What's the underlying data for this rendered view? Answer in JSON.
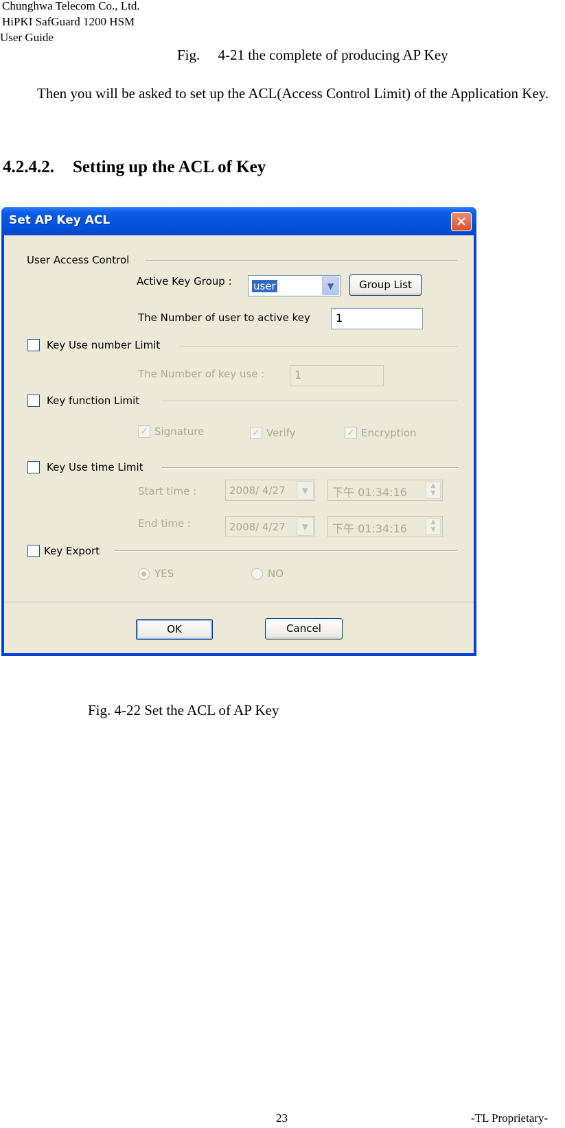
{
  "header": {
    "company": "Chunghwa Telecom Co., Ltd.",
    "product": "HiPKI SafGuard 1200 HSM",
    "doc": "User Guide"
  },
  "caption_prev": "Fig.  4-21 the complete of producing AP Key",
  "paragraph": "Then you will be asked to set up the ACL(Access Control Limit) of the Application Key.",
  "section": {
    "number": "4.2.4.2.",
    "title": "Setting up the ACL of Key"
  },
  "dialog": {
    "title": "Set AP Key ACL",
    "close_glyph": "✕",
    "user_access": {
      "group_label": "User Access Control",
      "active_group_label": "Active Key Group :",
      "active_group_value": "user",
      "group_list_button": "Group List",
      "num_users_label": "The Number of user to active key",
      "num_users_value": "1"
    },
    "key_use_number": {
      "label": "Key Use number Limit",
      "num_use_label": "The Number of key use :",
      "num_use_value": "1"
    },
    "key_function": {
      "label": "Key function Limit",
      "signature": "Signature",
      "verify": "Verify",
      "encryption": "Encryption"
    },
    "key_time": {
      "label": "Key Use time Limit",
      "start_label": "Start time :",
      "start_date": "2008/  4/27",
      "start_time": "下午 01:34:16",
      "end_label": "End time :",
      "end_date": "2008/  4/27",
      "end_time": "下午 01:34:16"
    },
    "key_export": {
      "label": "Key Export",
      "yes": "YES",
      "no": "NO"
    },
    "ok_button": "OK",
    "cancel_button": "Cancel"
  },
  "caption": "Fig. 4-22 Set the ACL of AP Key",
  "footer": {
    "page_number": "23",
    "proprietary": "-TL Proprietary-"
  }
}
